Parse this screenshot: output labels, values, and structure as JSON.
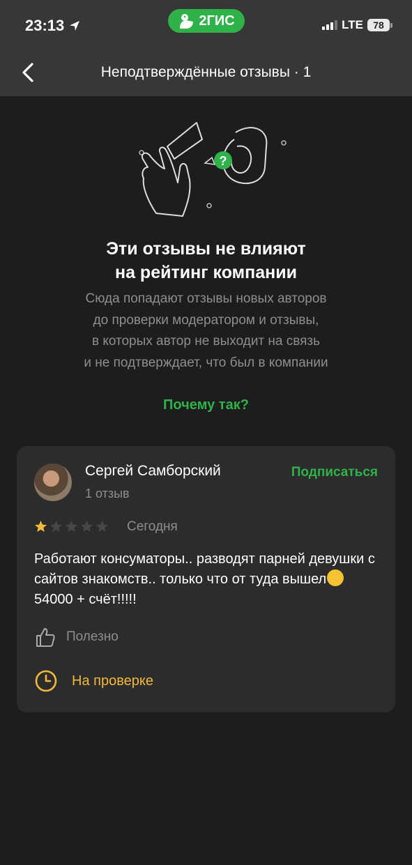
{
  "status_bar": {
    "time": "23:13",
    "brand": "2ГИС",
    "network": "LTE",
    "battery": "78",
    "icons": [
      "location-arrow-icon",
      "duck-logo-icon",
      "signal-icon",
      "battery-icon"
    ]
  },
  "nav": {
    "title": "Неподтверждённые отзывы · 1",
    "back_icon": "chevron-left-icon"
  },
  "info": {
    "headline_line1": "Эти отзывы не влияют",
    "headline_line2": "на рейтинг компании",
    "description_lines": [
      "Сюда попадают отзывы новых авторов",
      "до проверки модератором и отзывы,",
      "в которых автор не выходит на связь",
      "и не подтверждает, что был в компании"
    ],
    "why_link": "Почему так?"
  },
  "review": {
    "author": "Сергей Самборский",
    "review_count": "1 отзыв",
    "subscribe_label": "Подписаться",
    "rating": 1,
    "rating_max": 5,
    "date": "Сегодня",
    "text_before_emoji": "Работают консуматоры.. разводят парней девушки с сайтов знакомств.. только что от туда вышел",
    "emoji_icon": "flushed-face-emoji",
    "text_after_emoji": "54000 + счёт!!!!!",
    "useful_label": "Полезно",
    "moderation_label": "На проверке"
  },
  "colors": {
    "accent_green": "#2fb24a",
    "star_yellow": "#f3b93a",
    "moderation_yellow": "#f3b93a",
    "background": "#1d1d1d",
    "card": "#2c2c2c",
    "header": "#373737"
  }
}
